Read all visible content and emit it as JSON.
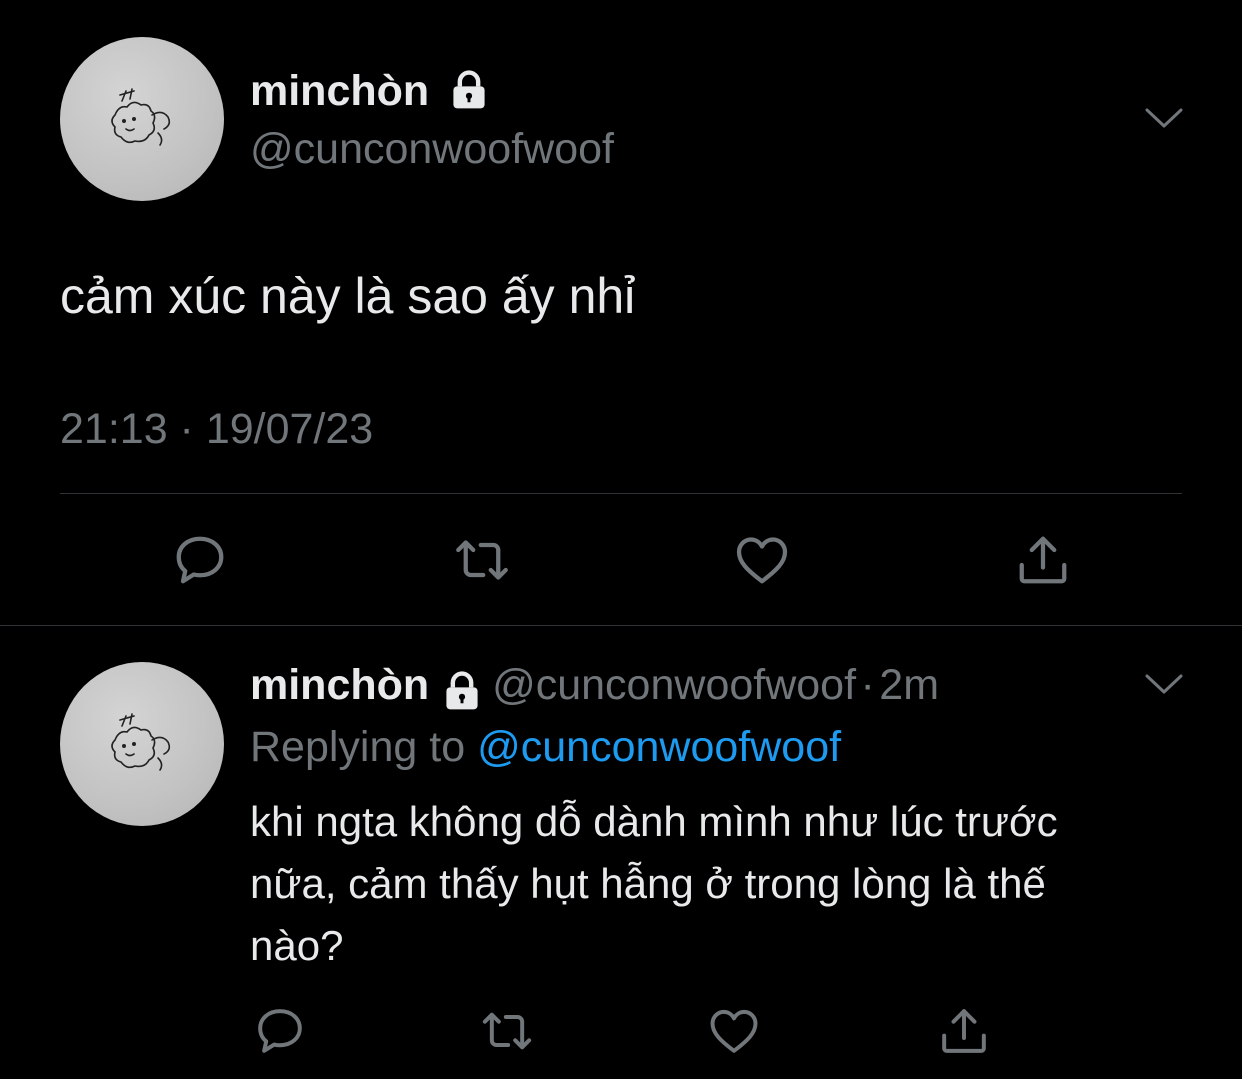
{
  "main_tweet": {
    "author_name": "minchòn",
    "handle": "@cunconwoofwoof",
    "text": "cảm xúc này là sao ấy nhỉ",
    "timestamp": "21:13 · 19/07/23"
  },
  "reply_tweet": {
    "author_name": "minchòn",
    "handle": "@cunconwoofwoof",
    "separator": "·",
    "time": "2m",
    "replying_to_label": "Replying to",
    "replying_to_handle": "@cunconwoofwoof",
    "text_lines": [
      "khi ngta không dỗ dành mình như lúc trước",
      "nữa, cảm thấy hụt hẫng ở trong lòng là thế",
      "nào?"
    ]
  },
  "actions": [
    "reply-icon",
    "retweet-icon",
    "like-icon",
    "share-icon"
  ],
  "colors": {
    "background": "#000000",
    "text": "#e7e9ea",
    "secondary": "#71767b",
    "link": "#1d9bf0",
    "divider": "#2f3336"
  }
}
